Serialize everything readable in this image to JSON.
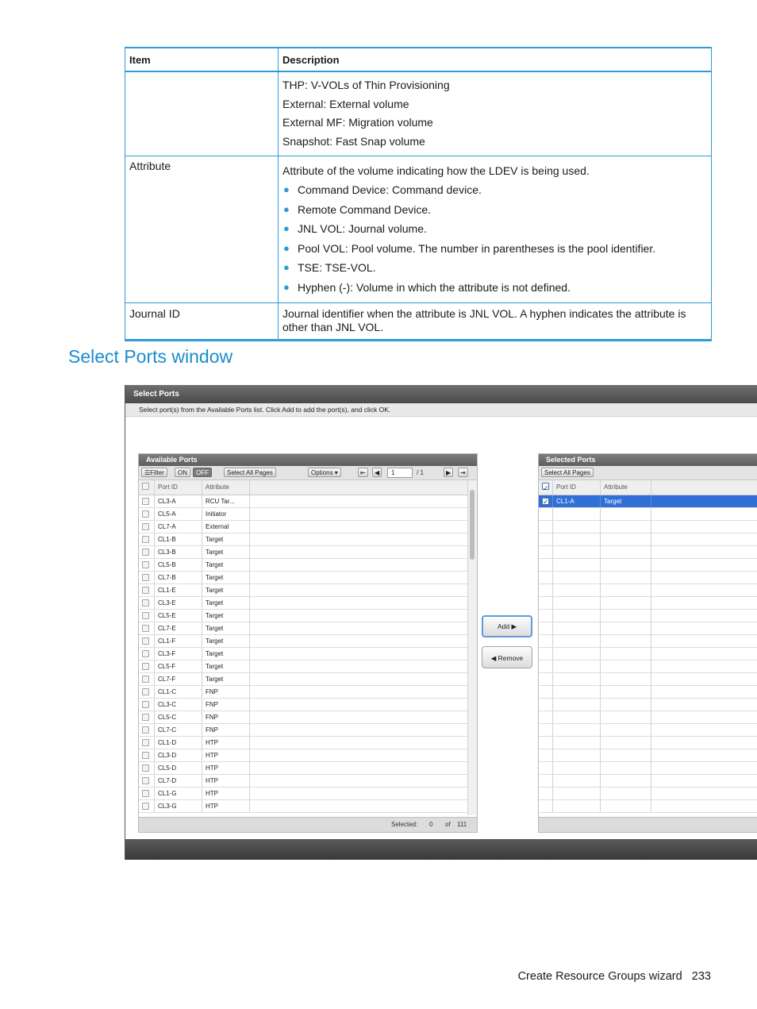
{
  "table": {
    "headers": [
      "Item",
      "Description"
    ],
    "row_continued": {
      "lines": [
        "THP: V-VOLs of Thin Provisioning",
        "External: External volume",
        "External MF: Migration volume",
        "Snapshot: Fast Snap volume"
      ]
    },
    "row_attribute": {
      "item": "Attribute",
      "intro": "Attribute of the volume indicating how the LDEV is being used.",
      "bullets": [
        "Command Device: Command device.",
        "Remote Command Device.",
        "JNL VOL: Journal volume.",
        "Pool VOL: Pool volume. The number in parentheses is the pool identifier.",
        "TSE: TSE-VOL.",
        "Hyphen (-): Volume in which the attribute is not defined."
      ]
    },
    "row_journal": {
      "item": "Journal ID",
      "description": "Journal identifier when the attribute is JNL VOL. A hyphen indicates the attribute is other than JNL VOL."
    }
  },
  "section_heading": "Select Ports window",
  "window": {
    "title": "Select Ports",
    "instruction": "Select port(s) from the Available Ports list. Click Add to add the port(s), and click OK.",
    "available": {
      "title": "Available Ports",
      "filter_label": "☰Filter",
      "on_label": "ON",
      "off_label": "OFF",
      "select_all_label": "Select All Pages",
      "options_label": "Options ▾",
      "first_icon": "⇤",
      "prev_icon": "◀",
      "page_value": "1",
      "page_total": "/ 1",
      "next_icon": "▶",
      "last_icon": "⇥",
      "columns": [
        "Port ID",
        "Attribute"
      ],
      "rows": [
        [
          "CL3-A",
          "RCU Tar..."
        ],
        [
          "CL5-A",
          "Initiator"
        ],
        [
          "CL7-A",
          "External"
        ],
        [
          "CL1-B",
          "Target"
        ],
        [
          "CL3-B",
          "Target"
        ],
        [
          "CL5-B",
          "Target"
        ],
        [
          "CL7-B",
          "Target"
        ],
        [
          "CL1-E",
          "Target"
        ],
        [
          "CL3-E",
          "Target"
        ],
        [
          "CL5-E",
          "Target"
        ],
        [
          "CL7-E",
          "Target"
        ],
        [
          "CL1-F",
          "Target"
        ],
        [
          "CL3-F",
          "Target"
        ],
        [
          "CL5-F",
          "Target"
        ],
        [
          "CL7-F",
          "Target"
        ],
        [
          "CL1-C",
          "FNP"
        ],
        [
          "CL3-C",
          "FNP"
        ],
        [
          "CL5-C",
          "FNP"
        ],
        [
          "CL7-C",
          "FNP"
        ],
        [
          "CL1-D",
          "HTP"
        ],
        [
          "CL3-D",
          "HTP"
        ],
        [
          "CL5-D",
          "HTP"
        ],
        [
          "CL7-D",
          "HTP"
        ],
        [
          "CL1-G",
          "HTP"
        ],
        [
          "CL3-G",
          "HTP"
        ]
      ],
      "selected_label": "Selected:",
      "selected_count": "0",
      "of_label": "of",
      "total_count": "111"
    },
    "add_button": "Add ▶",
    "remove_button": "◀ Remove",
    "selected": {
      "title": "Selected Ports",
      "select_all_label": "Select All Pages",
      "columns": [
        "Port ID",
        "Attribute"
      ],
      "rows": [
        [
          "CL1-A",
          "Target"
        ]
      ]
    }
  },
  "footer": {
    "text": "Create Resource Groups wizard",
    "page": "233"
  }
}
